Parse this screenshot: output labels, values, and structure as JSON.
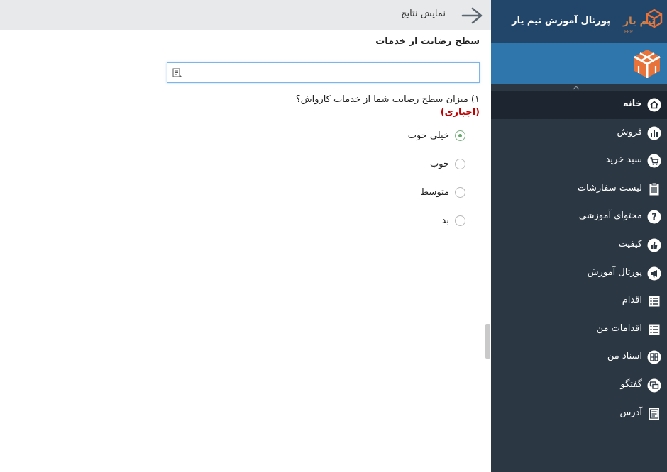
{
  "header": {
    "title": "نمایش نتایج"
  },
  "form": {
    "title": "سطح رضایت از خدمات",
    "search_value": "",
    "question": "۱) میزان سطح رضایت شما از خدمات کارواش؟",
    "required_label": "(اجباری)",
    "options": [
      {
        "label": "خیلی خوب",
        "checked": true
      },
      {
        "label": "خوب",
        "checked": false
      },
      {
        "label": "متوسط",
        "checked": false
      },
      {
        "label": "بد",
        "checked": false
      }
    ]
  },
  "sidebar": {
    "brand_title": "پورتال آموزش تیم یار",
    "brand_logo_text": "تیم یار",
    "brand_logo_sub": "ERP",
    "items": [
      {
        "label": "خانه",
        "icon": "home-icon",
        "active": true
      },
      {
        "label": "فروش",
        "icon": "bar-chart-icon",
        "active": false
      },
      {
        "label": "سبد خرید",
        "icon": "cart-icon",
        "active": false
      },
      {
        "label": "لیست سفارشات",
        "icon": "clipboard-icon",
        "active": false
      },
      {
        "label": "محتواي آموزشي",
        "icon": "question-icon",
        "active": false
      },
      {
        "label": "کیفیت",
        "icon": "thumbs-up-icon",
        "active": false
      },
      {
        "label": "پورتال آموزش",
        "icon": "megaphone-icon",
        "active": false
      },
      {
        "label": "اقدام",
        "icon": "list-icon",
        "active": false
      },
      {
        "label": "اقدامات من",
        "icon": "list-icon",
        "active": false
      },
      {
        "label": "اسناد من",
        "icon": "documents-icon",
        "active": false
      },
      {
        "label": "گفتگو",
        "icon": "chat-icon",
        "active": false
      },
      {
        "label": "آدرس",
        "icon": "address-list-icon",
        "active": false
      }
    ]
  },
  "colors": {
    "sidebar_bg": "#2b3743",
    "brand_bg": "#22456a",
    "user_band_bg": "#2f76ad",
    "required": "#c00000",
    "radio_checked": "#68a86f",
    "logo_orange": "#e8733a"
  }
}
